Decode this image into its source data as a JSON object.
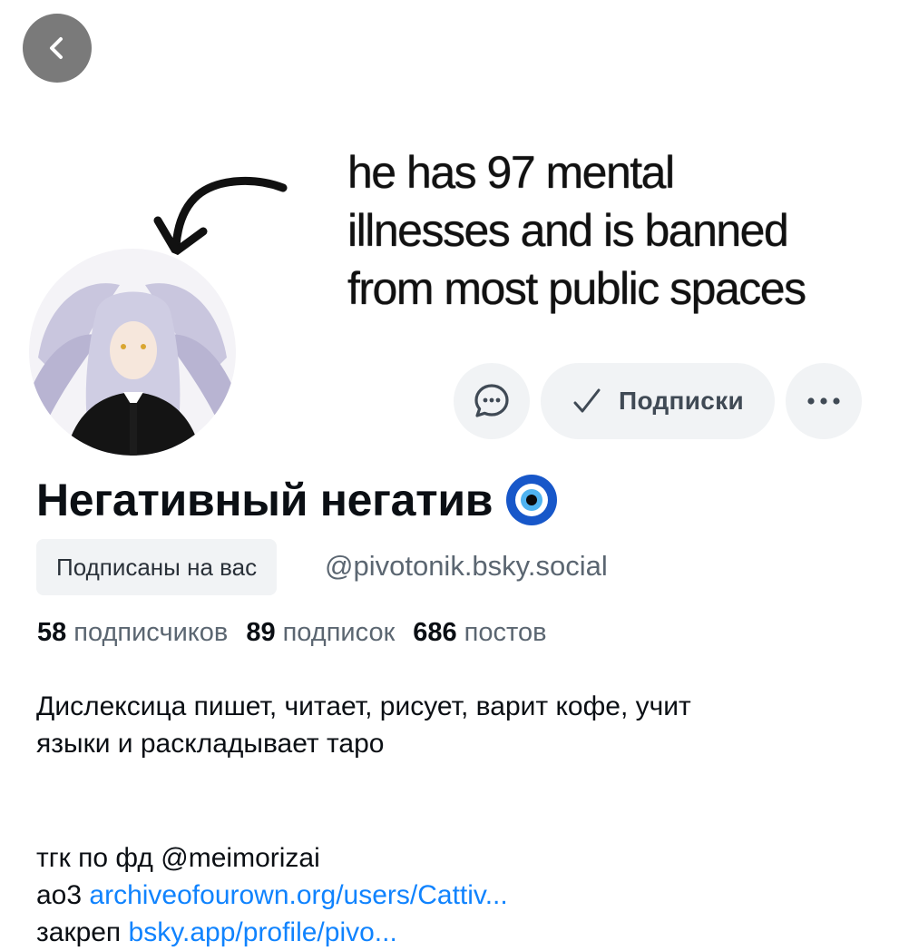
{
  "banner": {
    "lines": [
      "he has 97 mental",
      "illnesses and is banned",
      "from most public spaces"
    ]
  },
  "nav": {
    "back_icon": "chevron-left-icon"
  },
  "actions": {
    "message_icon": "chat-bubble-icon",
    "follow_icon": "checkmark-icon",
    "follow_label": "Подписки",
    "more_icon": "ellipsis-icon"
  },
  "profile": {
    "display_name": "Негативный негатив",
    "name_emoji": "🧿",
    "follows_you": "Подписаны на вас",
    "handle": "@pivotonik.bsky.social"
  },
  "stats": {
    "followers_count": "58",
    "followers_label": "подписчиков",
    "following_count": "89",
    "following_label": "подписок",
    "posts_count": "686",
    "posts_label": "постов"
  },
  "bio": {
    "line1": "Дислексица пишет, читает, рисует, варит кофе, учит",
    "line2": "языки и раскладывает таро",
    "tgk_prefix": "тгк по фд",
    "tgk_mention": "@meimorizai",
    "ao3_prefix": "ао3",
    "ao3_link": "archiveofourown.org/users/Cattiv...",
    "pin_prefix": "закреп",
    "pin_link": "bsky.app/profile/pivo..."
  },
  "colors": {
    "accent_link": "#1083fe",
    "button_bg": "#f1f3f5",
    "muted_text": "#5b6671",
    "back_button_bg": "#7a7a7a"
  }
}
